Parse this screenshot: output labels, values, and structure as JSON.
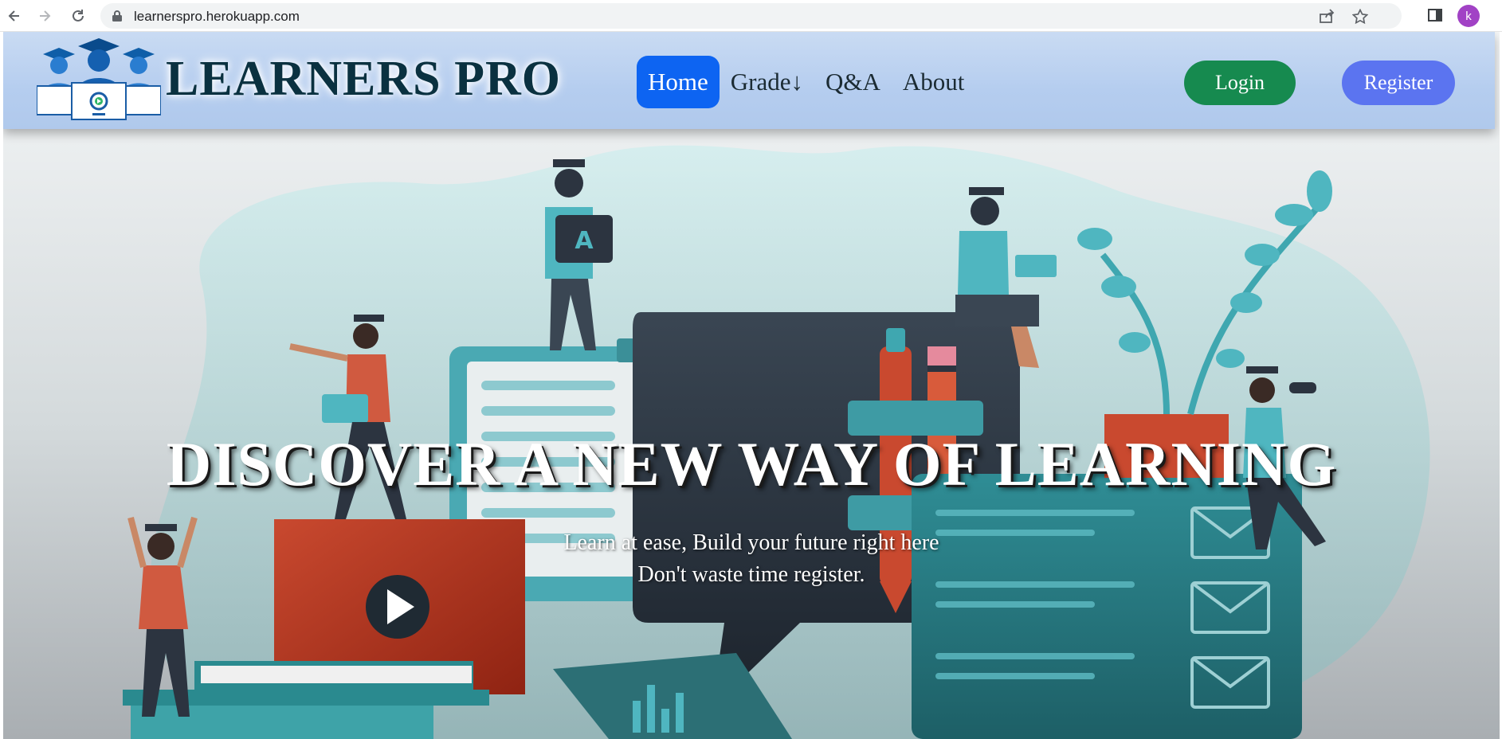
{
  "browser": {
    "url": "learnerspro.herokuapp.com",
    "avatar_letter": "k",
    "icons": [
      "back-arrow-icon",
      "forward-arrow-icon",
      "reload-icon",
      "lock-icon",
      "share-icon",
      "star-icon",
      "side-panel-icon"
    ]
  },
  "header": {
    "brand": "LEARNERS PRO",
    "nav": [
      {
        "label": "Home",
        "active": true
      },
      {
        "label": "Grade↓",
        "active": false
      },
      {
        "label": "Q&A",
        "active": false
      },
      {
        "label": "About",
        "active": false
      }
    ],
    "login_label": "Login",
    "register_label": "Register"
  },
  "hero": {
    "title": "DISCOVER A NEW WAY OF LEARNING",
    "subtitle_line1": "Learn at ease, Build your future right here",
    "subtitle_line2": "Don't waste time register."
  },
  "colors": {
    "active_nav": "#0d64f2",
    "login_button": "#168a4f",
    "register_button": "#5b74f0",
    "brand_text": "#0a3140",
    "teal_illustration": "#3fa7b0",
    "orange_illustration": "#c9492f",
    "dark_illustration": "#2c3440"
  }
}
